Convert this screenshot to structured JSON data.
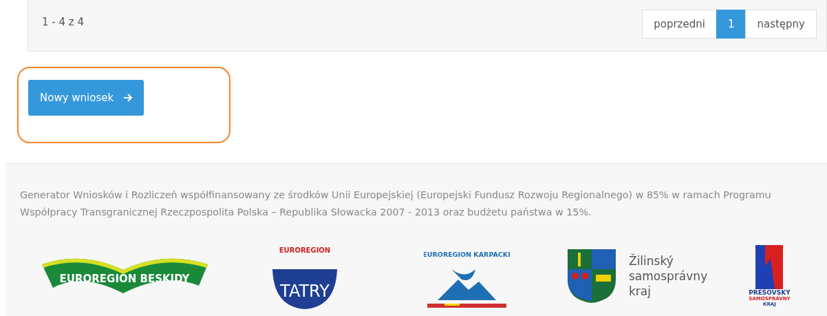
{
  "pagination": {
    "summary": "1 - 4 z 4",
    "buttons": [
      {
        "label": "poprzedni",
        "selected": false
      },
      {
        "label": "1",
        "selected": true
      },
      {
        "label": "następny",
        "selected": false
      }
    ]
  },
  "new_button": {
    "label": "Nowy wniosek",
    "highlighted": true
  },
  "footer": {
    "text": "Generator Wniosków i Rozliczeń współfinansowany ze środków Unii Europejskiej (Europejski Fundusz Rozwoju Regionalnego) w 85% w ramach Programu Współpracy Transgranicznej Rzeczpospolita Polska – Republika Słowacka 2007 - 2013 oraz budżetu państwa w 15%.",
    "logos": [
      {
        "kind": "beskidy",
        "texts": [
          "EUROREGION BESKIDY"
        ]
      },
      {
        "kind": "tatry",
        "texts": [
          "EUROREGION",
          "TATRY"
        ]
      },
      {
        "kind": "karpacki",
        "texts": [
          "EUROREGION KARPACKI"
        ]
      },
      {
        "kind": "zilina",
        "texts": [
          "Žilinský",
          "samosprávny",
          "kraj"
        ]
      },
      {
        "kind": "presov",
        "texts": [
          "PREŠOVSKÝ",
          "SAMOSPRÁVNY",
          "KRAJ"
        ]
      }
    ]
  }
}
